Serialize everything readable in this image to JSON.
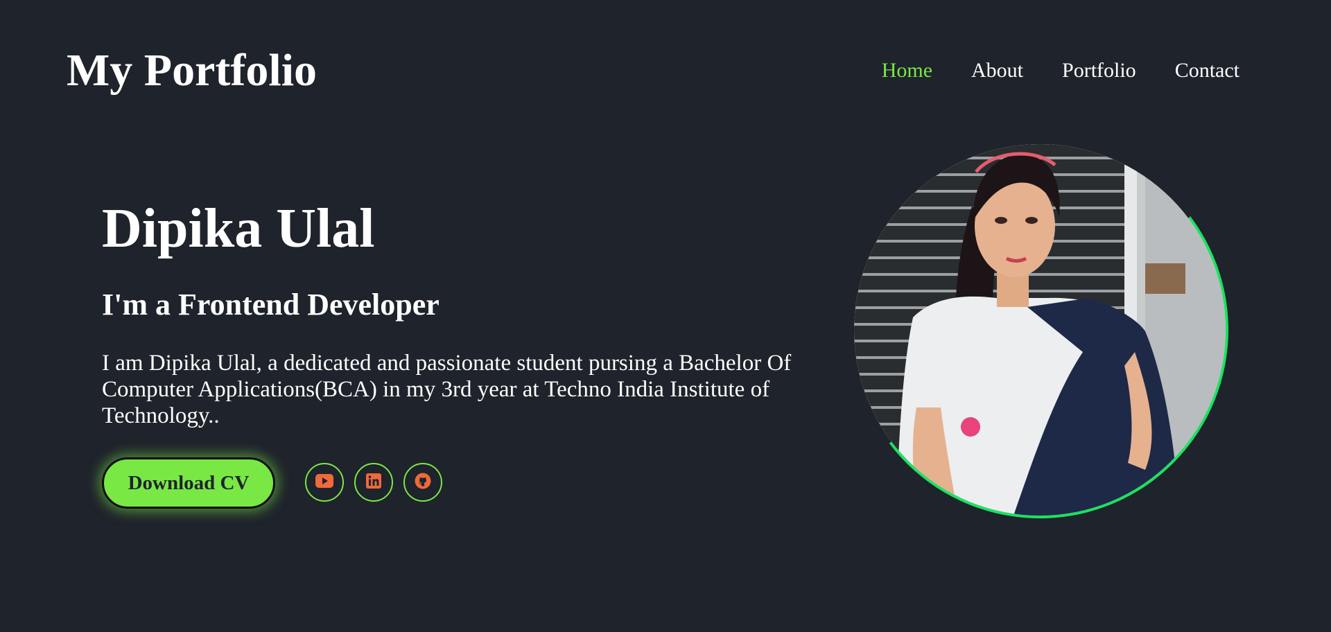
{
  "header": {
    "logo": "My Portfolio",
    "nav": [
      {
        "label": "Home",
        "active": true
      },
      {
        "label": "About",
        "active": false
      },
      {
        "label": "Portfolio",
        "active": false
      },
      {
        "label": "Contact",
        "active": false
      }
    ]
  },
  "hero": {
    "name": "Dipika Ulal",
    "role": "I'm a Frontend Developer",
    "description": "I am Dipika Ulal, a dedicated and passionate student pursing a Bachelor Of Computer Applications(BCA) in my 3rd year at Techno India Institute of Technology..",
    "cv_button": "Download CV",
    "socials": [
      {
        "icon": "youtube-icon"
      },
      {
        "icon": "linkedin-icon"
      },
      {
        "icon": "github-icon"
      }
    ]
  },
  "colors": {
    "background": "#1f232b",
    "accent": "#79e845",
    "ring": "#19e35f",
    "icon": "#ee6a3a"
  }
}
